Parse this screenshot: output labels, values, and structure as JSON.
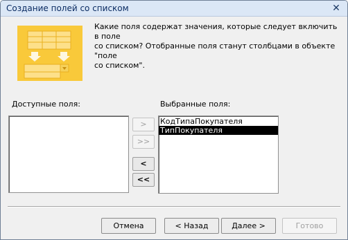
{
  "window": {
    "title": "Создание полей со списком",
    "close_glyph": "✕"
  },
  "description": "Какие поля содержат значения, которые следует включить в поле\nсо списком? Отобранные поля станут столбцами в объекте \"поле\nсо списком\".",
  "available": {
    "label": "Доступные поля:",
    "items": []
  },
  "selected": {
    "label": "Выбранные поля:",
    "items": [
      {
        "text": "КодТипаПокупателя",
        "selected": false
      },
      {
        "text": "ТипПокупателя",
        "selected": true
      }
    ]
  },
  "move_buttons": {
    "add_one": ">",
    "add_all": ">>",
    "remove_one": "<",
    "remove_all": "<<"
  },
  "footer": {
    "cancel": "Отмена",
    "back": "< Назад",
    "next": "Далее >",
    "finish": "Готово"
  },
  "colors": {
    "graphic": "#f9c93a",
    "graphic_shade": "#e9b020",
    "selection": "#000000"
  },
  "icons": {
    "wizard_graphic": "combo-box-wizard-icon",
    "close": "close-icon"
  }
}
